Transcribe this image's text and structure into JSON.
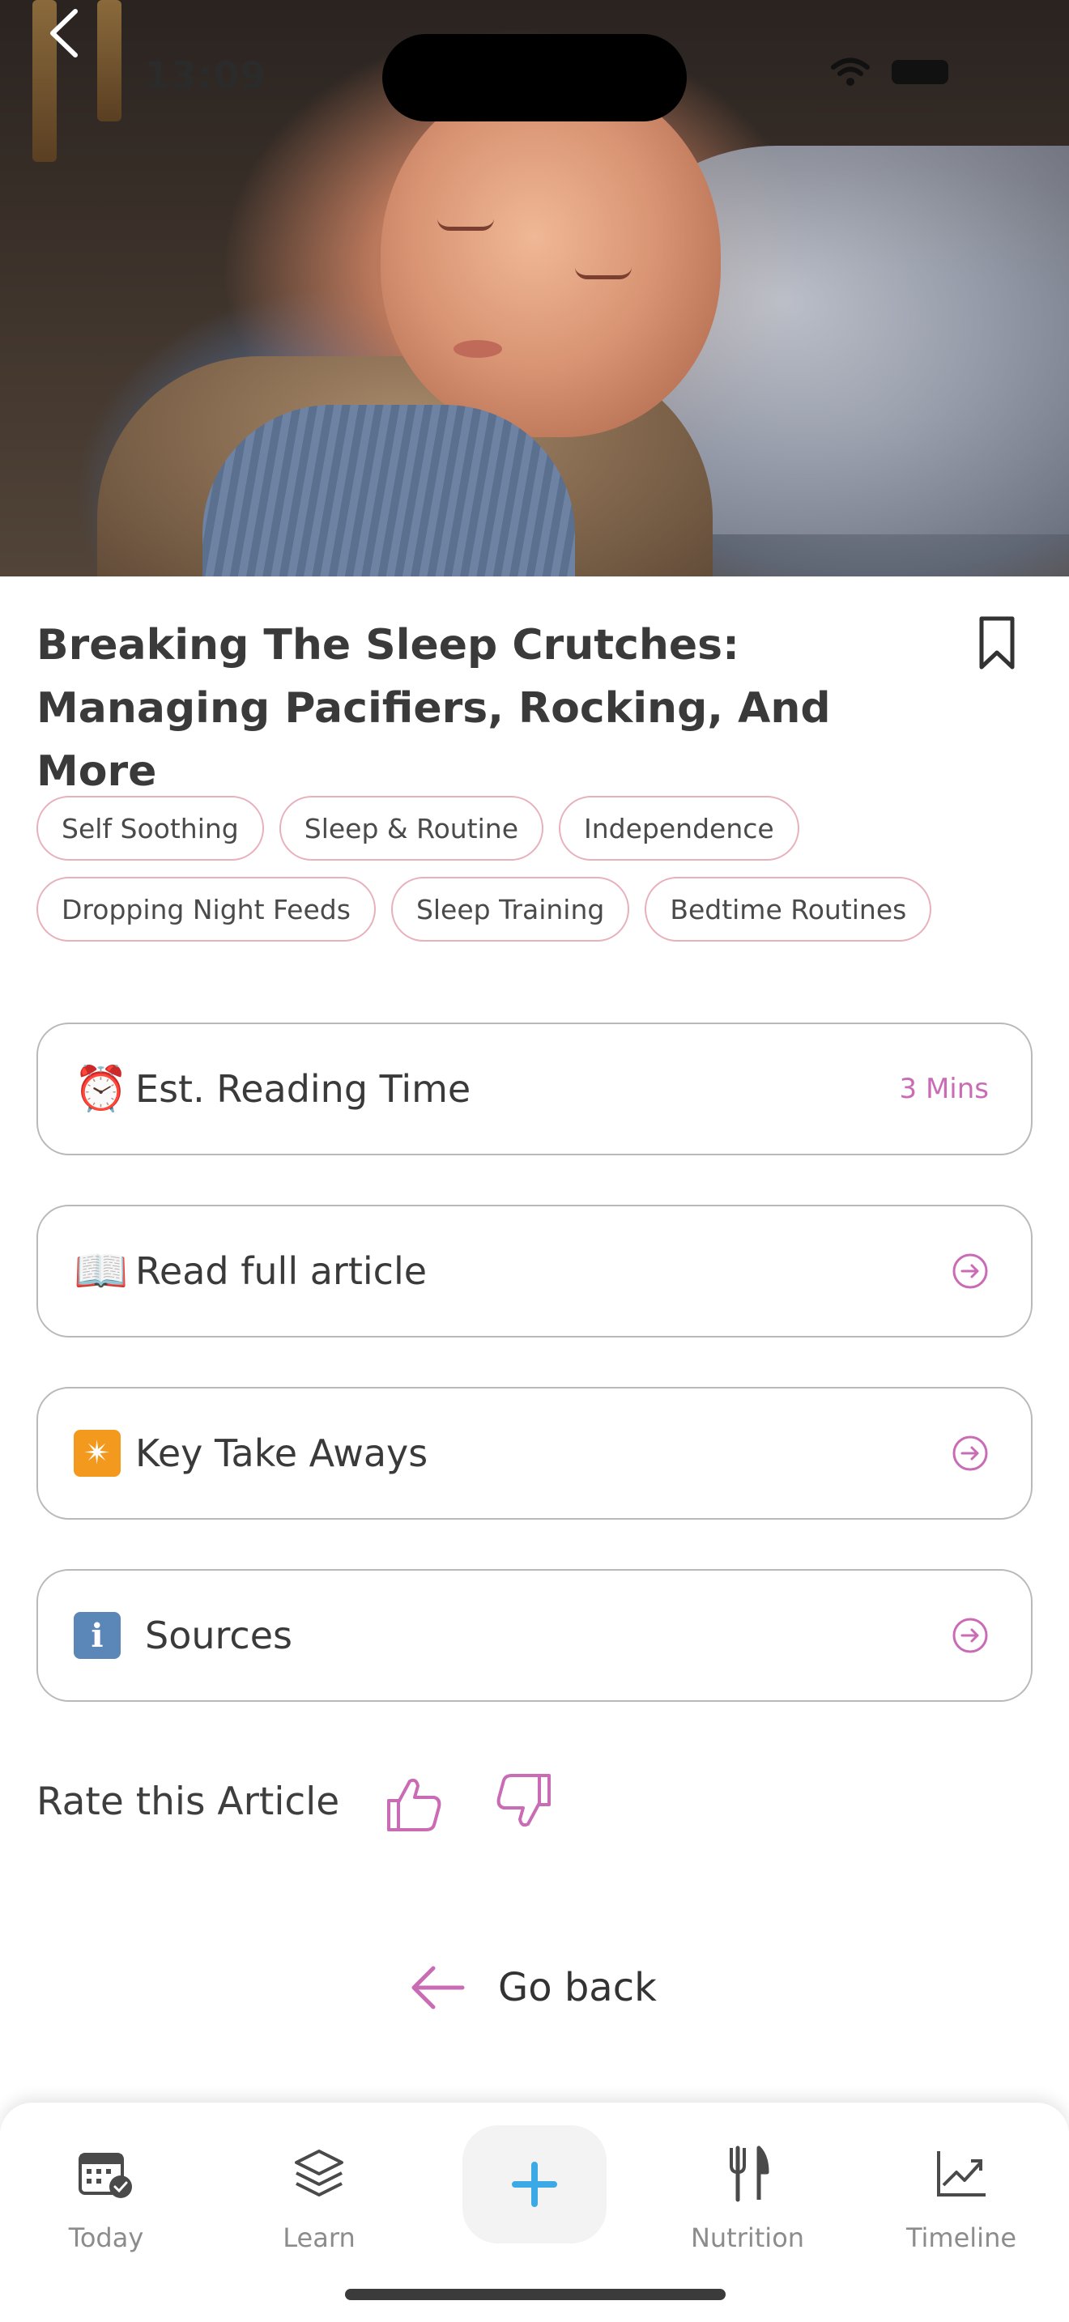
{
  "status_bar": {
    "time": "13:09"
  },
  "article": {
    "title": "Breaking The Sleep Crutches: Managing Pacifiers, Rocking, And More",
    "tags": [
      "Self Soothing",
      "Sleep & Routine",
      "Independence",
      "Dropping Night Feeds",
      "Sleep Training",
      "Bedtime Routines"
    ]
  },
  "cards": {
    "reading_time": {
      "emoji": "⏰",
      "label": "Est. Reading Time",
      "value": "3 Mins"
    },
    "read_full": {
      "emoji": "📖",
      "label": "Read full article"
    },
    "key_takeaways": {
      "emoji": "✴",
      "label": "Key Take Aways"
    },
    "sources": {
      "emoji": "i",
      "label": "Sources"
    }
  },
  "rate": {
    "label": "Rate this Article"
  },
  "go_back": {
    "label": "Go back"
  },
  "bottom_nav": {
    "items": [
      {
        "label": "Today",
        "icon": "calendar-check-icon"
      },
      {
        "label": "Learn",
        "icon": "layers-icon"
      },
      {
        "label": "Nutrition",
        "icon": "fork-knife-icon"
      },
      {
        "label": "Timeline",
        "icon": "trend-chart-icon"
      }
    ]
  },
  "colors": {
    "accent": "#c96cb5",
    "tag_border": "#e7b0bb",
    "plus": "#3aa9e6"
  }
}
